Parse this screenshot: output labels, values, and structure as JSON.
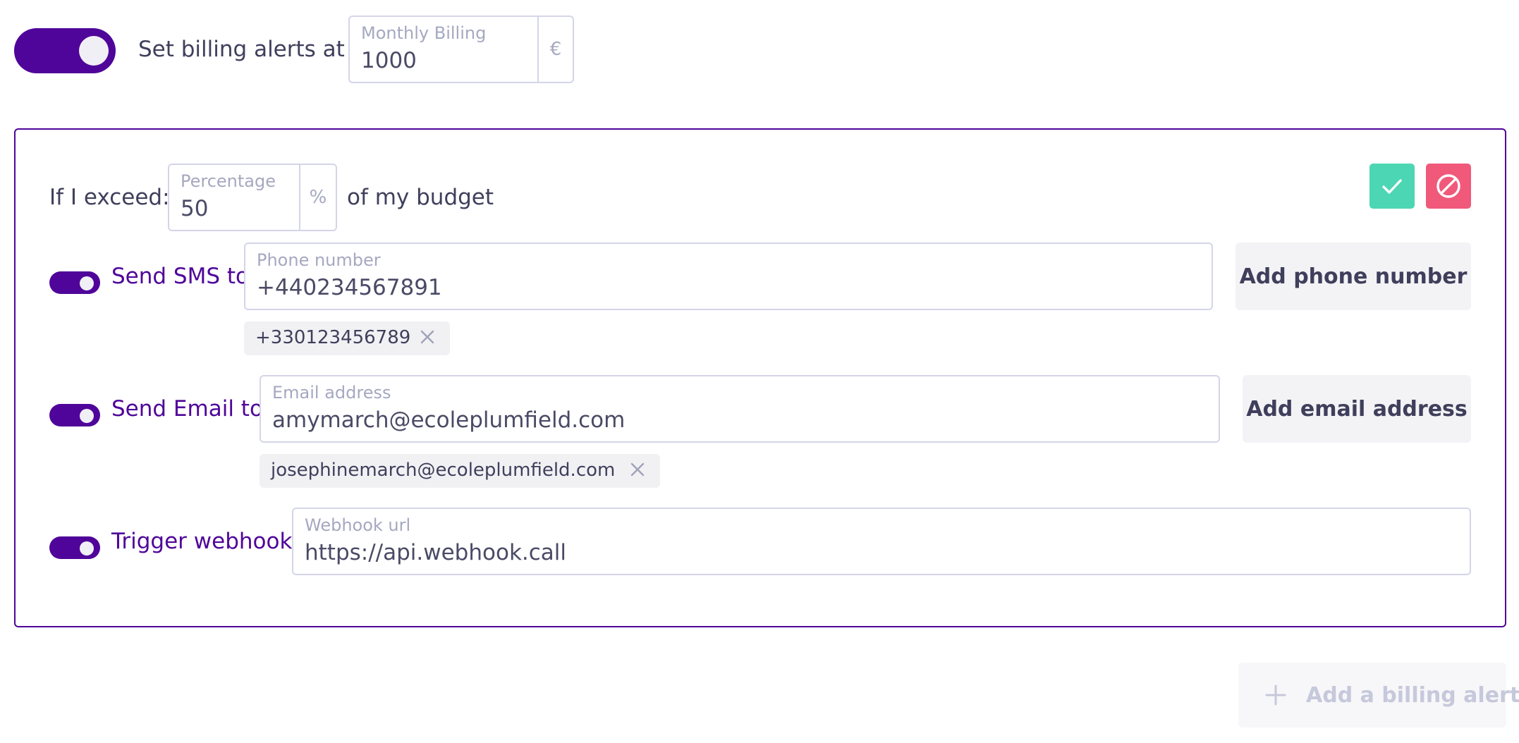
{
  "billing": {
    "label": "Set billing alerts at",
    "monthly_label": "Monthly Billing",
    "monthly_value": "1000",
    "currency": "€",
    "enabled": true
  },
  "alert": {
    "exceed_label": "If I exceed:",
    "percentage_label": "Percentage",
    "percentage_value": "50",
    "percent_unit": "%",
    "budget_suffix": "of my budget",
    "sms": {
      "enabled": true,
      "label": "Send SMS to",
      "field_label": "Phone number",
      "field_value": "+440234567891",
      "add_button": "Add phone number",
      "chips": [
        "+330123456789"
      ]
    },
    "email": {
      "enabled": true,
      "label": "Send Email to",
      "field_label": "Email address",
      "field_value": "amymarch@ecoleplumfield.com",
      "add_button": "Add email address",
      "chips": [
        "josephinemarch@ecoleplumfield.com"
      ]
    },
    "webhook": {
      "enabled": true,
      "label": "Trigger webhook",
      "field_label": "Webhook url",
      "field_value": "https://api.webhook.call"
    }
  },
  "add_alert_label": "Add a billing alert",
  "colors": {
    "accent": "#4f0599",
    "confirm": "#4cd6b4",
    "cancel": "#f0597a",
    "border": "#d4d5e8"
  },
  "icons": {
    "confirm": "check-icon",
    "cancel": "cancel-icon",
    "chip_remove": "close-icon",
    "add": "plus-icon"
  }
}
